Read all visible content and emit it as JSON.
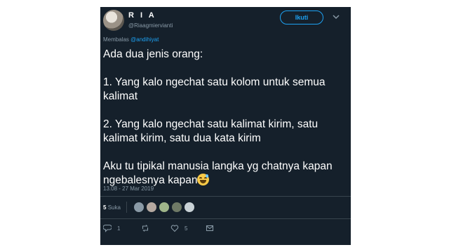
{
  "user": {
    "display_name": "R I A",
    "handle": "@Riaagmiervianti"
  },
  "follow_button": {
    "label": "Ikuti"
  },
  "reply_to": {
    "prefix": "Membalas",
    "mention": "@andihiyat"
  },
  "tweet": {
    "paragraphs": [
      "Ada dua jenis orang:",
      "1. Yang kalo ngechat satu kolom untuk semua kalimat",
      "2. Yang kalo ngechat satu kalimat kirim, satu kalimat kirim, satu dua kata kirim",
      "Aku tu tipikal manusia langka yg chatnya kapan ngebalesnya kapan"
    ],
    "emoji": "sweat-smile-emoji",
    "timestamp": "13.08 - 27 Mar 2019"
  },
  "likes": {
    "count": "5",
    "label": "Suka",
    "avatar_colors": [
      "#8a9aa6",
      "#b5a9a0",
      "#9fb58a",
      "#6f7a66",
      "#c9d2d6"
    ]
  },
  "actions": {
    "reply_count": "1",
    "retweet_count": "",
    "like_count": "5"
  },
  "colors": {
    "background": "#15202b",
    "accent": "#1da1f2",
    "muted": "#8899a6"
  }
}
